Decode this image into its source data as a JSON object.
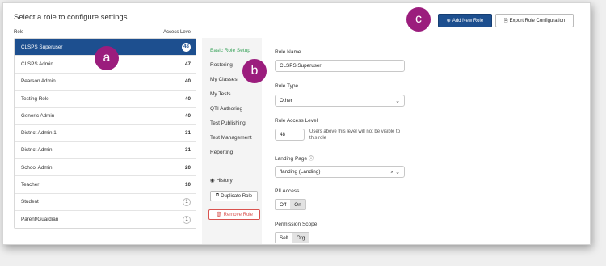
{
  "intro": "Select a role to configure settings.",
  "buttons": {
    "add": "Add New Role",
    "export": "Export Role Configuration",
    "duplicate": "Duplicate Role",
    "remove": "Remove Role"
  },
  "headers": {
    "role": "Role",
    "access": "Access Level"
  },
  "roles": [
    {
      "name": "CLSPS Superuser",
      "level": "48"
    },
    {
      "name": "CLSPS Admin",
      "level": "47"
    },
    {
      "name": "Pearson Admin",
      "level": "40"
    },
    {
      "name": "Testing Role",
      "level": "40"
    },
    {
      "name": "Generic Admin",
      "level": "40"
    },
    {
      "name": "District Admin 1",
      "level": "31"
    },
    {
      "name": "District Admin",
      "level": "31"
    },
    {
      "name": "School Admin",
      "level": "20"
    },
    {
      "name": "Teacher",
      "level": "10"
    },
    {
      "name": "Student",
      "level": "1"
    },
    {
      "name": "Parent/Guardian",
      "level": "1"
    }
  ],
  "nav": [
    "Basic Role Setup",
    "Rostering",
    "My Classes",
    "My Tests",
    "QTI Authoring",
    "Test Publishing",
    "Test Management",
    "Reporting"
  ],
  "history": "History",
  "form": {
    "role_name_label": "Role Name",
    "role_name_value": "CLSPS Superuser",
    "role_type_label": "Role Type",
    "role_type_value": "Other",
    "access_level_label": "Role Access Level",
    "access_level_value": "48",
    "access_hint": "Users above this level will not be visible to this role",
    "landing_label": "Landing Page",
    "landing_value": "/landing (Landing)",
    "pii_label": "PII Access",
    "pii_off": "Off",
    "pii_on": "On",
    "scope_label": "Permission Scope",
    "scope_self": "Self",
    "scope_org": "Org"
  },
  "callouts": {
    "a": "a",
    "b": "b",
    "c": "c"
  },
  "colors": {
    "primary": "#1d4f8f",
    "active_nav": "#3aa35b",
    "callout": "#9b1d7d",
    "danger": "#d9534f"
  }
}
